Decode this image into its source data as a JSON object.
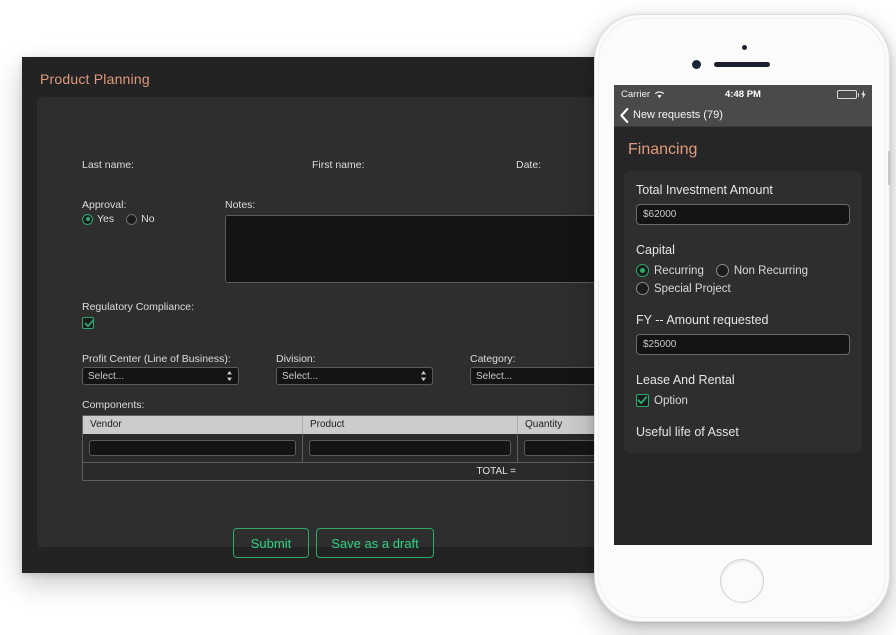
{
  "desktop": {
    "title": "Product Planning",
    "fields": {
      "last_name_label": "Last name:",
      "first_name_label": "First name:",
      "date_label": "Date:",
      "approval_label": "Approval:",
      "notes_label": "Notes:",
      "regulatory_label": "Regulatory Compliance:",
      "components_label": "Components:"
    },
    "approval_options": [
      {
        "label": "Yes",
        "selected": true
      },
      {
        "label": "No",
        "selected": false
      }
    ],
    "regulatory_checked": true,
    "selects": [
      {
        "label": "Profit Center (Line of Business):",
        "value": "Select..."
      },
      {
        "label": "Division:",
        "value": "Select..."
      },
      {
        "label": "Category:",
        "value": "Select..."
      }
    ],
    "components_table": {
      "columns": [
        "Vendor",
        "Product",
        "Quantity"
      ],
      "rows": [
        [
          "",
          "",
          ""
        ]
      ],
      "total_label": "TOTAL ="
    },
    "buttons": [
      {
        "label": "Submit"
      },
      {
        "label": "Save as a draft"
      }
    ]
  },
  "phone": {
    "statusbar": {
      "carrier": "Carrier",
      "wifi_icon": "wifi-icon",
      "time": "4:48 PM",
      "battery_icon": "battery-charging-icon"
    },
    "navbar": {
      "back_icon": "chevron-left-icon",
      "title": "New requests (79)"
    },
    "screen_title": "Financing",
    "sections": [
      {
        "label": "Total Investment Amount",
        "type": "input",
        "value": "$62000"
      },
      {
        "label": "Capital",
        "type": "radio",
        "options": [
          {
            "label": "Recurring",
            "selected": true
          },
          {
            "label": "Non Recurring",
            "selected": false
          },
          {
            "label": "Special Project",
            "selected": false
          }
        ]
      },
      {
        "label": "FY -- Amount requested",
        "type": "input",
        "value": "$25000"
      },
      {
        "label": "Lease And Rental",
        "type": "checkbox",
        "options": [
          {
            "label": "Option",
            "checked": true
          }
        ]
      },
      {
        "label": "Useful life of Asset",
        "type": "label-only"
      }
    ]
  },
  "colors": {
    "accent_title": "#e09a7e",
    "accent_green": "#2ea96c",
    "button_text": "#2fd184",
    "panel_bg": "#2e2e2e",
    "window_bg": "#232323",
    "input_bg": "#141414",
    "table_head_bg": "#cccccc",
    "battery_green": "#4cd964"
  }
}
